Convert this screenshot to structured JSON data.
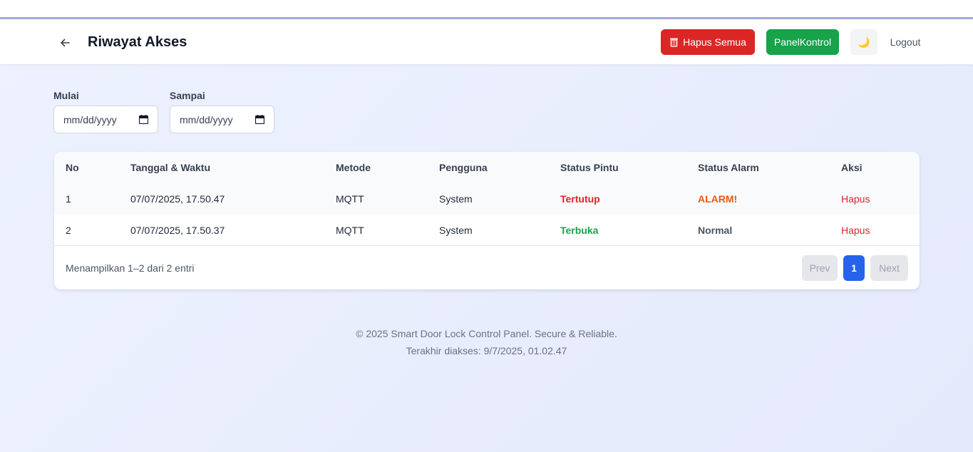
{
  "header": {
    "title": "Riwayat Akses",
    "delete_all_label": "Hapus Semua",
    "panel_label": "PanelKontrol",
    "theme_icon": "🌙",
    "logout_label": "Logout"
  },
  "filters": {
    "start_label": "Mulai",
    "start_placeholder": "mm/dd/yyyy",
    "end_label": "Sampai",
    "end_placeholder": "mm/dd/yyyy"
  },
  "table": {
    "columns": [
      "No",
      "Tanggal & Waktu",
      "Metode",
      "Pengguna",
      "Status Pintu",
      "Status Alarm",
      "Aksi"
    ],
    "rows": [
      {
        "no": "1",
        "datetime": "07/07/2025, 17.50.47",
        "method": "MQTT",
        "user": "System",
        "door": "Tertutup",
        "alarm": "ALARM!",
        "action": "Hapus"
      },
      {
        "no": "2",
        "datetime": "07/07/2025, 17.50.37",
        "method": "MQTT",
        "user": "System",
        "door": "Terbuka",
        "alarm": "Normal",
        "action": "Hapus"
      }
    ]
  },
  "pagination": {
    "summary": "Menampilkan 1–2 dari 2 entri",
    "prev": "Prev",
    "current": "1",
    "next": "Next"
  },
  "footer": {
    "copyright": "© 2025 Smart Door Lock Control Panel. Secure & Reliable.",
    "last_access": "Terakhir diakses: 9/7/2025, 01.02.47"
  },
  "colors": {
    "danger": "#dc2626",
    "success": "#16a34a",
    "warning": "#ea580c",
    "primary": "#2563eb"
  }
}
